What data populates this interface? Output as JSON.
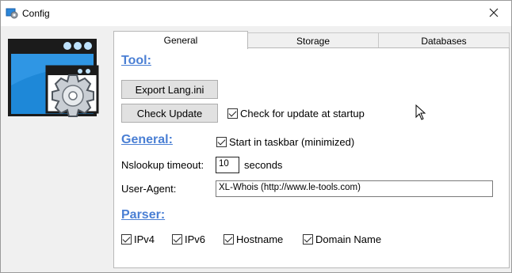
{
  "window": {
    "title": "Config",
    "icons": {
      "app": "gear-window-icon",
      "close": "close-icon"
    }
  },
  "tabs": [
    {
      "label": "General",
      "active": true
    },
    {
      "label": "Storage",
      "active": false
    },
    {
      "label": "Databases",
      "active": false
    }
  ],
  "tool": {
    "heading": "Tool:",
    "export_label": "Export Lang.ini",
    "check_update_label": "Check Update",
    "check_startup": {
      "label": "Check for update at startup",
      "checked": true
    }
  },
  "general": {
    "heading": "General:",
    "start_taskbar": {
      "label": "Start in taskbar (minimized)",
      "checked": true
    },
    "nslookup_label": "Nslookup timeout:",
    "nslookup_value": "10",
    "nslookup_unit": "seconds",
    "user_agent_label": "User-Agent:",
    "user_agent_value": "XL-Whois (http://www.le-tools.com)"
  },
  "parser": {
    "heading": "Parser:",
    "options": [
      {
        "label": "IPv4",
        "checked": true
      },
      {
        "label": "IPv6",
        "checked": true
      },
      {
        "label": "Hostname",
        "checked": true
      },
      {
        "label": "Domain Name",
        "checked": true
      }
    ]
  },
  "colors": {
    "section_heading": "#4a7fd4",
    "logo_screen": "#1e88d8"
  }
}
